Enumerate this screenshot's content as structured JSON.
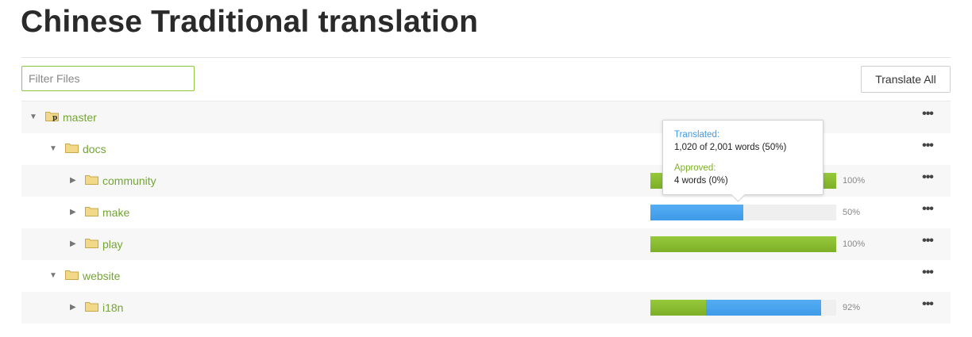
{
  "header": {
    "title": "Chinese Traditional translation"
  },
  "toolbar": {
    "filter_placeholder": "Filter Files",
    "filter_value": "",
    "translate_all_label": "Translate All"
  },
  "colors": {
    "accent_green": "#8dc63f",
    "translated_blue": "#3e9ae8",
    "approved_green": "#7db028"
  },
  "tree": [
    {
      "name": "master",
      "expanded": true,
      "icon": "branch-folder-icon",
      "progress": null,
      "more": "•••"
    },
    {
      "name": "docs",
      "expanded": true,
      "icon": "folder-icon",
      "progress": null,
      "more": "•••"
    },
    {
      "name": "community",
      "expanded": false,
      "icon": "folder-icon",
      "progress": {
        "approved": 100,
        "translated": 0,
        "label": "100%"
      },
      "more": "•••"
    },
    {
      "name": "make",
      "expanded": false,
      "icon": "folder-icon",
      "progress": {
        "approved": 0,
        "translated": 50,
        "label": "50%"
      },
      "more": "•••"
    },
    {
      "name": "play",
      "expanded": false,
      "icon": "folder-icon",
      "progress": {
        "approved": 100,
        "translated": 0,
        "label": "100%"
      },
      "more": "•••"
    },
    {
      "name": "website",
      "expanded": true,
      "icon": "folder-icon",
      "progress": null,
      "more": "•••"
    },
    {
      "name": "i18n",
      "expanded": false,
      "icon": "folder-icon",
      "progress": {
        "approved": 30,
        "translated": 62,
        "label": "92%"
      },
      "more": "•••"
    }
  ],
  "tooltip": {
    "translated_label": "Translated:",
    "translated_value": "1,020 of 2,001 words (50%)",
    "approved_label": "Approved:",
    "approved_value": "4 words (0%)"
  }
}
